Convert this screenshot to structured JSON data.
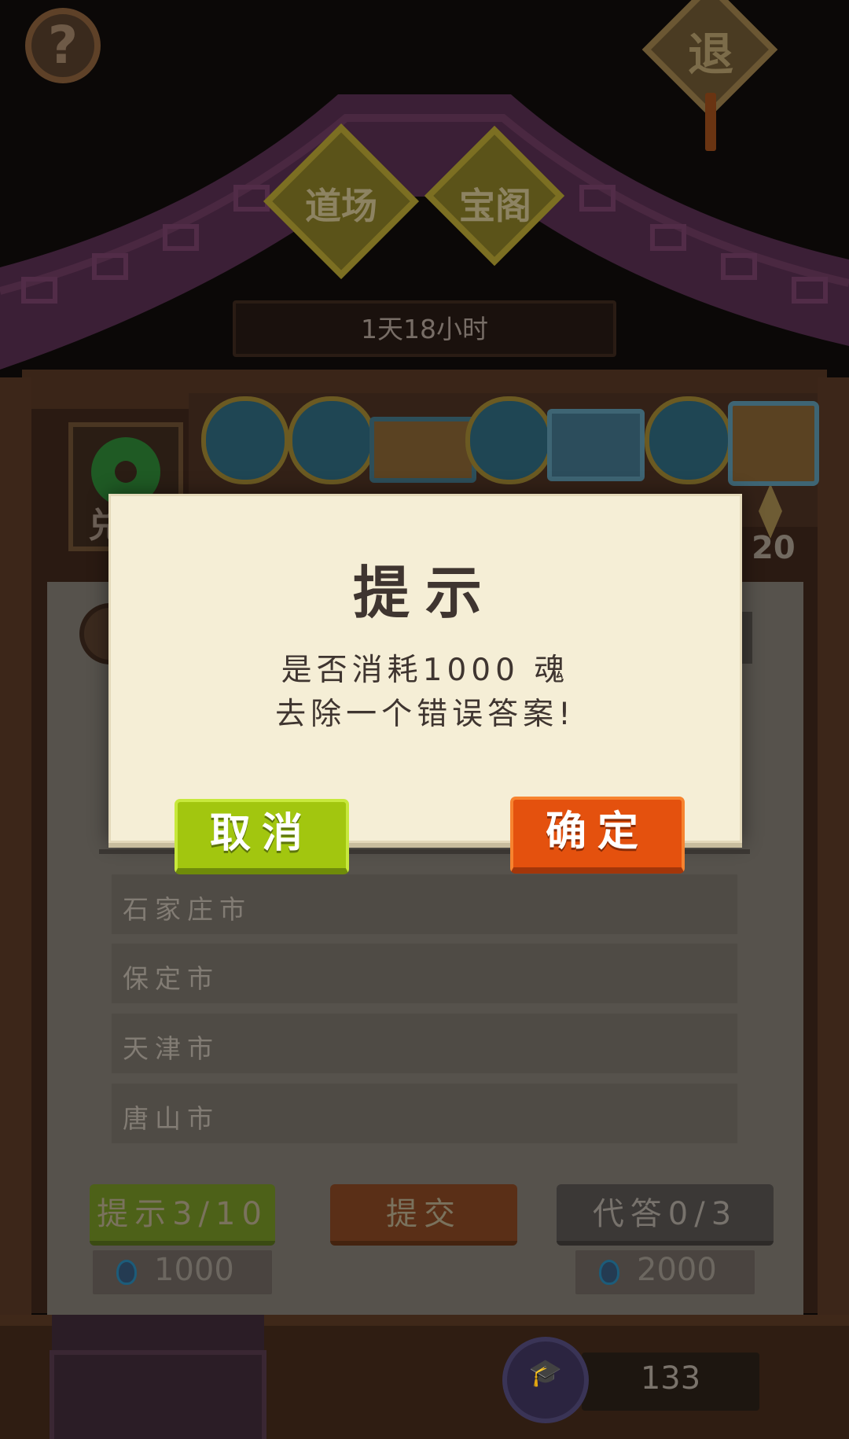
{
  "header": {
    "help_icon": "?",
    "exit_label": "退",
    "tabs": [
      {
        "label": "道场"
      },
      {
        "label": "宝阁"
      }
    ],
    "timer": "1天18小时"
  },
  "side": {
    "left_label_fragment": "兑",
    "right_count": "20"
  },
  "reward_icons": [
    "coin-bag-icon",
    "coin-bag-icon",
    "treasure-box-icon",
    "coin-bag-icon",
    "treasure-box-icon",
    "coin-bag-icon",
    "treasure-chest-icon"
  ],
  "quiz": {
    "options": [
      "石家庄市",
      "保定市",
      "天津市",
      "唐山市"
    ],
    "actions": {
      "hint_label": "提示3/10",
      "hint_cost": "1000",
      "submit_label": "提交",
      "proxy_label": "代答0/3",
      "proxy_cost": "2000"
    }
  },
  "footer": {
    "score": "133"
  },
  "dialog": {
    "title": "提示",
    "message_line1": "是否消耗1000 魂",
    "message_line2": "去除一个错误答案!",
    "cancel_label": "取消",
    "confirm_label": "确定"
  },
  "colors": {
    "cancel_green": "#a2c60f",
    "confirm_orange": "#e4510e",
    "dialog_paper": "#f5eed6"
  }
}
